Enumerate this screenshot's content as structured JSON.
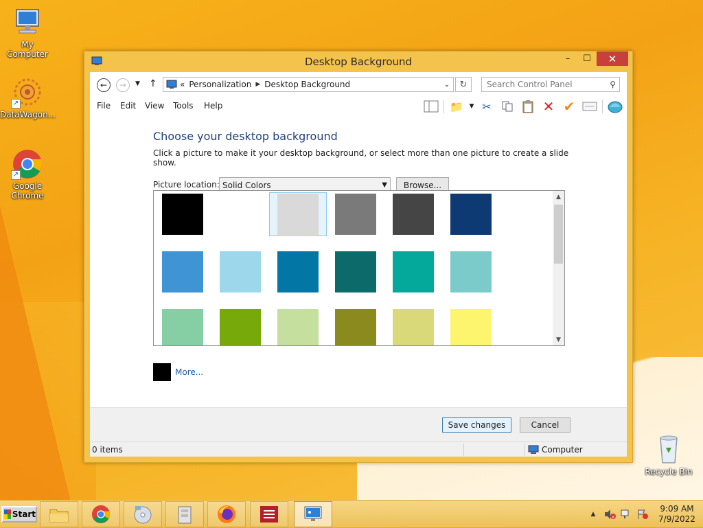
{
  "desktop": {
    "icons": [
      {
        "label": "My Computer"
      },
      {
        "label": "DataWagon..."
      },
      {
        "label": "Google Chrome"
      },
      {
        "label": "Recycle Bin"
      }
    ]
  },
  "window": {
    "title": "Desktop Background",
    "controls": {
      "minimize": "–",
      "maximize": "☐",
      "close": "✕"
    },
    "address": {
      "prefix": "«",
      "crumbs": [
        "Personalization",
        "Desktop Background"
      ]
    },
    "search": {
      "placeholder": "Search Control Panel"
    },
    "menu": [
      "File",
      "Edit",
      "View",
      "Tools",
      "Help"
    ],
    "content": {
      "heading": "Choose your desktop background",
      "subtext": "Click a picture to make it your desktop background, or select more than one picture to create a slide show.",
      "location_label": "Picture location:",
      "location_value": "Solid Colors",
      "browse_label": "Browse...",
      "more_label": "More...",
      "more_color": "#000000"
    },
    "swatches": [
      {
        "color": "#000000",
        "selected": false
      },
      {
        "color": "#ffffff",
        "selected": false
      },
      {
        "color": "#d9d9d9",
        "selected": true
      },
      {
        "color": "#7a7a7a",
        "selected": false
      },
      {
        "color": "#454545",
        "selected": false
      },
      {
        "color": "#0e3a74",
        "selected": false
      },
      {
        "color": "#3f94d4",
        "selected": false
      },
      {
        "color": "#9dd7ec",
        "selected": false
      },
      {
        "color": "#0277a6",
        "selected": false
      },
      {
        "color": "#0d6a6a",
        "selected": false
      },
      {
        "color": "#04a99b",
        "selected": false
      },
      {
        "color": "#7ccbcb",
        "selected": false
      },
      {
        "color": "#86cea3",
        "selected": false
      },
      {
        "color": "#78a90b",
        "selected": false
      },
      {
        "color": "#c5df9f",
        "selected": false
      },
      {
        "color": "#8a8a1f",
        "selected": false
      },
      {
        "color": "#d9d97a",
        "selected": false
      },
      {
        "color": "#fdf56d",
        "selected": false
      }
    ],
    "footer": {
      "save_label": "Save changes",
      "cancel_label": "Cancel"
    },
    "status": {
      "items": "0 items",
      "location": "Computer"
    }
  },
  "taskbar": {
    "start_label": "Start",
    "clock_time": "9:09 AM",
    "clock_date": "7/9/2022"
  },
  "colors": {
    "heading": "#1f3e79",
    "link": "#1f5ea8",
    "close_button": "#c7403a",
    "window_frame": "#f4c34c"
  }
}
